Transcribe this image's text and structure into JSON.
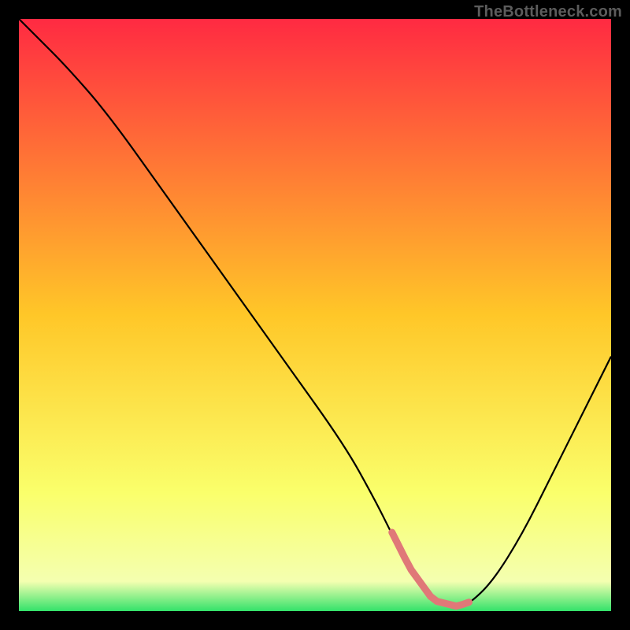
{
  "watermark": "TheBottleneck.com",
  "chart_data": {
    "type": "line",
    "title": "",
    "xlabel": "",
    "ylabel": "",
    "xlim": [
      0,
      100
    ],
    "ylim": [
      0,
      100
    ],
    "background_gradient": {
      "stops": [
        {
          "offset": 0,
          "color": "#ff2a42"
        },
        {
          "offset": 50,
          "color": "#ffc728"
        },
        {
          "offset": 80,
          "color": "#faff6b"
        },
        {
          "offset": 95,
          "color": "#f4ffb0"
        },
        {
          "offset": 100,
          "color": "#33e26a"
        }
      ]
    },
    "series": [
      {
        "name": "bottleneck-curve",
        "color": "#000000",
        "x": [
          0,
          3,
          8,
          15,
          25,
          35,
          45,
          55,
          60,
          63,
          66,
          70,
          74,
          76,
          80,
          85,
          90,
          95,
          100
        ],
        "y": [
          100,
          97,
          92,
          84,
          70,
          56,
          42,
          28,
          19,
          13,
          7,
          1.5,
          0.5,
          1.2,
          5,
          13,
          23,
          33,
          43
        ]
      }
    ],
    "highlight": {
      "name": "optimal-range",
      "color": "#e07878",
      "x_range": [
        63,
        76
      ],
      "y": 0.8
    }
  }
}
